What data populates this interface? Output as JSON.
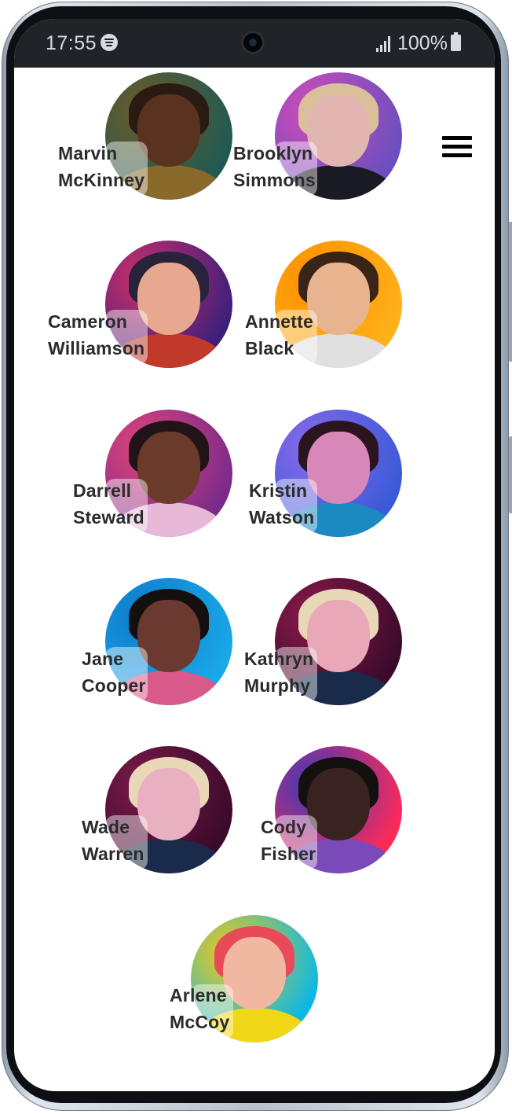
{
  "status_bar": {
    "time": "17:55",
    "app_icon": "spotify-icon",
    "battery": "100%"
  },
  "header": {
    "menu_icon": "hamburger-menu-icon"
  },
  "contacts": [
    {
      "first": "Marvin",
      "last": "McKinney",
      "colors": {
        "bg": "#1f5a52",
        "bg2": "#6b5a2a",
        "skin": "#5a3320",
        "hair": "#2a1a12",
        "body": "#8a6a2a"
      }
    },
    {
      "first": "Brooklyn",
      "last": "Simmons",
      "colors": {
        "bg": "#6a4fbf",
        "bg2": "#d04cb8",
        "skin": "#e2b6b0",
        "hair": "#d9c09a",
        "body": "#1a1a22"
      }
    },
    {
      "first": "Cameron",
      "last": "Williamson",
      "colors": {
        "bg": "#3b1f7a",
        "bg2": "#d0306a",
        "skin": "#e7a88f",
        "hair": "#28223a",
        "body": "#c0392b"
      }
    },
    {
      "first": "Annette",
      "last": "Black",
      "colors": {
        "bg": "#ffb11a",
        "bg2": "#ff8f00",
        "skin": "#e8b48f",
        "hair": "#3a2418",
        "body": "#e0e0e0"
      }
    },
    {
      "first": "Darrell",
      "last": "Steward",
      "colors": {
        "bg": "#7a2a8a",
        "bg2": "#e0457a",
        "skin": "#6a3a2a",
        "hair": "#201418",
        "body": "#e8b8d8"
      }
    },
    {
      "first": "Kristin",
      "last": "Watson",
      "colors": {
        "bg": "#3a5ad8",
        "bg2": "#8a6ae8",
        "skin": "#d888b8",
        "hair": "#2a1420",
        "body": "#1a8ac0"
      }
    },
    {
      "first": "Jane",
      "last": "Cooper",
      "colors": {
        "bg": "#1aa8e8",
        "bg2": "#0e7ac8",
        "skin": "#6a3a30",
        "hair": "#141010",
        "body": "#d85a8a"
      }
    },
    {
      "first": "Kathryn",
      "last": "Murphy",
      "colors": {
        "bg": "#3a0a2a",
        "bg2": "#8a1a4a",
        "skin": "#e8a8b8",
        "hair": "#e8d8b8",
        "body": "#1a2a4a"
      }
    },
    {
      "first": "Wade",
      "last": "Warren",
      "colors": {
        "bg": "#3a0a2a",
        "bg2": "#7a1a4a",
        "skin": "#e8b0c0",
        "hair": "#e8d8b8",
        "body": "#1a2a4a"
      }
    },
    {
      "first": "Cody",
      "last": "Fisher",
      "colors": {
        "bg": "#ff2a58",
        "bg2": "#3a3ab8",
        "skin": "#3a2220",
        "hair": "#141010",
        "body": "#7a4ab8"
      }
    },
    {
      "first": "Arlene",
      "last": "McCoy",
      "colors": {
        "bg": "#0ab8e8",
        "bg2": "#f0c818",
        "skin": "#f0b8a0",
        "hair": "#e84a5a",
        "body": "#f0d818"
      }
    }
  ]
}
